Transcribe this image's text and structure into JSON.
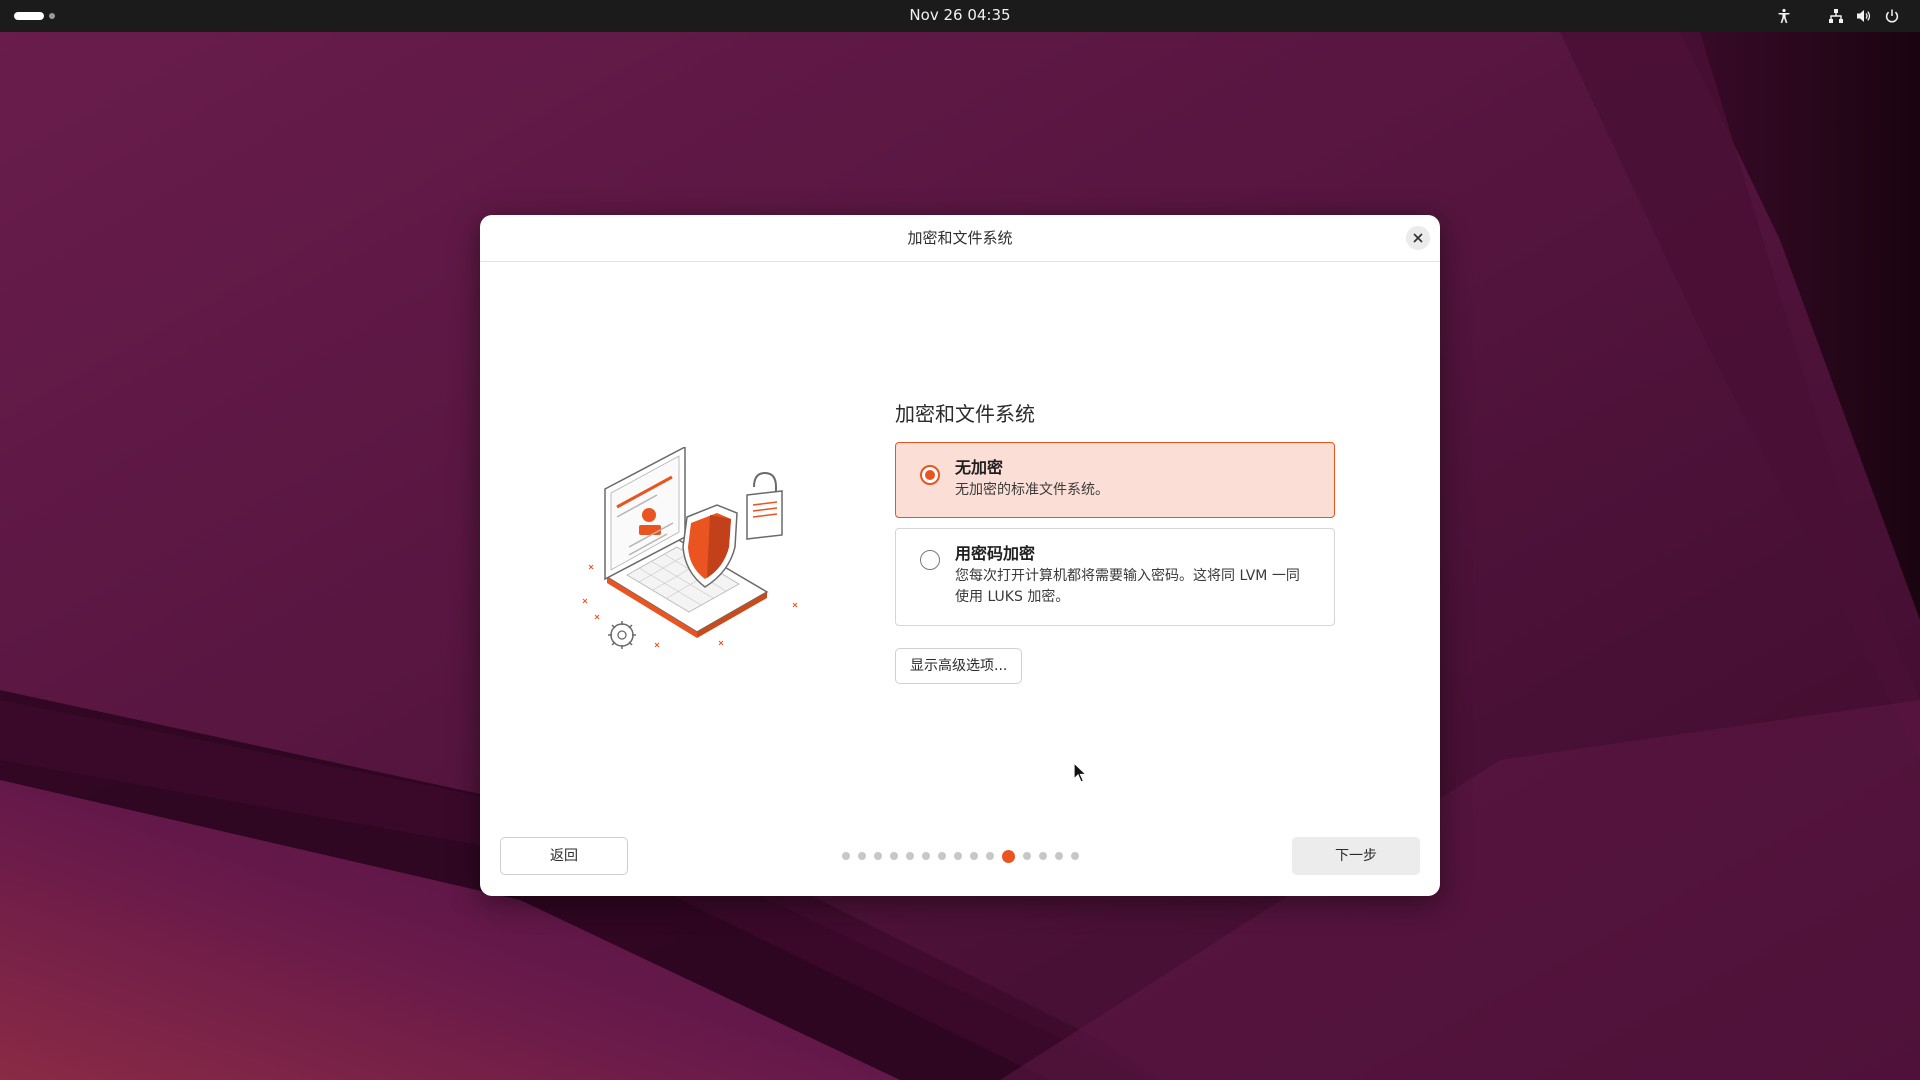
{
  "topbar": {
    "clock": "Nov 26  04:35",
    "icons": [
      "accessibility-icon",
      "network-icon",
      "volume-icon",
      "power-icon"
    ]
  },
  "dialog": {
    "title": "加密和文件系统",
    "section_title": "加密和文件系统",
    "options": [
      {
        "label": "无加密",
        "description": "无加密的标准文件系统。",
        "selected": true
      },
      {
        "label": "用密码加密",
        "description_line1": "您每次打开计算机都将需要输入密码。这将同 LVM 一同",
        "description_line2": "使用 LUKS 加密。",
        "selected": false
      }
    ],
    "advanced_button": "显示高级选项...",
    "back_button": "返回",
    "next_button": "下一步",
    "pager": {
      "total_steps": 15,
      "current_step": 11
    }
  },
  "colors": {
    "accent": "#e95420",
    "selected_bg": "#fbdfd7",
    "topbar_bg": "#1b1b1b"
  }
}
